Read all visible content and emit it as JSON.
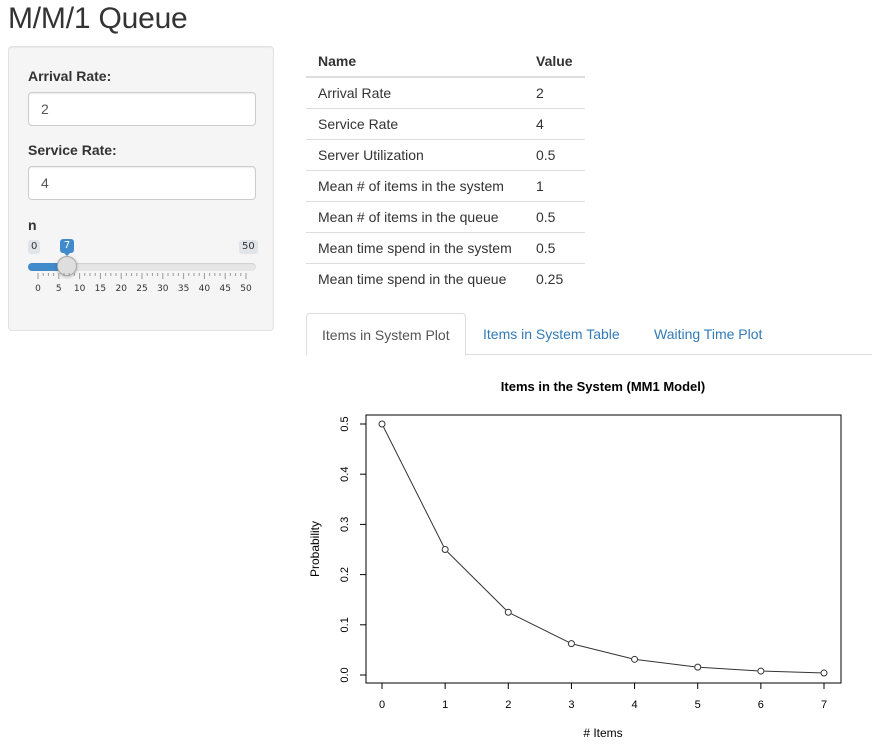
{
  "app": {
    "title": "M/M/1 Queue"
  },
  "sidebar": {
    "arrival_rate": {
      "label": "Arrival Rate:",
      "value": "2"
    },
    "service_rate": {
      "label": "Service Rate:",
      "value": "4"
    },
    "n_slider": {
      "label": "n",
      "min": "0",
      "max": "50",
      "value": "7",
      "value_num": 7,
      "min_num": 0,
      "max_num": 50,
      "tick_labels": [
        "0",
        "5",
        "10",
        "15",
        "20",
        "25",
        "30",
        "35",
        "40",
        "45",
        "50"
      ]
    },
    "accent_color": "#428bca"
  },
  "summary_table": {
    "headers": [
      "Name",
      "Value"
    ],
    "rows": [
      {
        "name": "Arrival Rate",
        "value": "2"
      },
      {
        "name": "Service Rate",
        "value": "4"
      },
      {
        "name": "Server Utilization",
        "value": "0.5"
      },
      {
        "name": "Mean # of items in the system",
        "value": "1"
      },
      {
        "name": "Mean # of items in the queue",
        "value": "0.5"
      },
      {
        "name": "Mean time spend in the system",
        "value": "0.5"
      },
      {
        "name": "Mean time spend in the queue",
        "value": "0.25"
      }
    ]
  },
  "tabs": [
    {
      "label": "Items in System Plot",
      "active": true
    },
    {
      "label": "Items in System Table",
      "active": false
    },
    {
      "label": "Waiting Time Plot",
      "active": false
    }
  ],
  "chart_data": {
    "type": "line",
    "title": "Items in the System (MM1 Model)",
    "xlabel": "# Items",
    "ylabel": "Probability",
    "x": [
      0,
      1,
      2,
      3,
      4,
      5,
      6,
      7
    ],
    "y": [
      0.5,
      0.25,
      0.125,
      0.0625,
      0.03125,
      0.015625,
      0.0078125,
      0.00390625
    ],
    "xlim": [
      0,
      7
    ],
    "ylim": [
      0,
      0.5
    ],
    "x_ticks": [
      "0",
      "1",
      "2",
      "3",
      "4",
      "5",
      "6",
      "7"
    ],
    "y_ticks": [
      "0.0",
      "0.1",
      "0.2",
      "0.3",
      "0.4",
      "0.5"
    ],
    "y_tick_values": [
      0,
      0.1,
      0.2,
      0.3,
      0.4,
      0.5
    ],
    "markers": "open-circle",
    "grid": false,
    "legend": "none"
  }
}
